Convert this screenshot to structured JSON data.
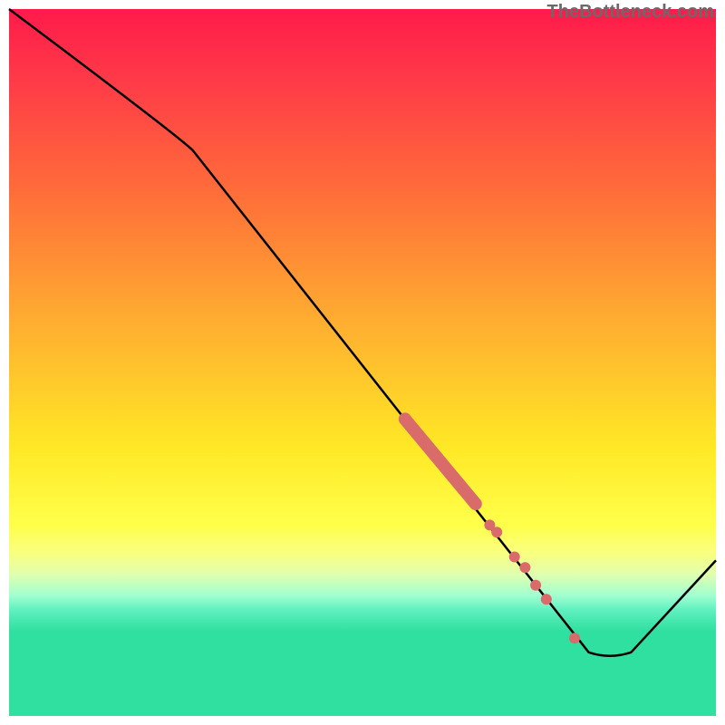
{
  "watermark": "TheBottleneck.com",
  "colors": {
    "curve": "#000000",
    "marker": "#d96b6b"
  },
  "chart_data": {
    "type": "line",
    "title": "",
    "xlabel": "",
    "ylabel": "",
    "xlim": [
      0,
      100
    ],
    "ylim": [
      0,
      100
    ],
    "grid": false,
    "curve": [
      {
        "x": 0,
        "y": 100
      },
      {
        "x": 26,
        "y": 80
      },
      {
        "x": 82,
        "y": 9
      },
      {
        "x": 88,
        "y": 9
      },
      {
        "x": 100,
        "y": 22
      }
    ],
    "highlight_segments": [
      {
        "x0": 56,
        "x1": 66,
        "y0": 42,
        "y1": 30,
        "style": "thick"
      }
    ],
    "highlight_points": [
      {
        "x": 68,
        "y": 27
      },
      {
        "x": 69,
        "y": 26
      },
      {
        "x": 71.5,
        "y": 22.5
      },
      {
        "x": 73,
        "y": 21
      },
      {
        "x": 74.5,
        "y": 18.5
      },
      {
        "x": 76,
        "y": 16.5
      },
      {
        "x": 80,
        "y": 11
      }
    ],
    "note": "x,y in 0..100, y measured upward from bottom of the square plot area; values estimated from pixel positions (no axes or tick labels present)."
  }
}
